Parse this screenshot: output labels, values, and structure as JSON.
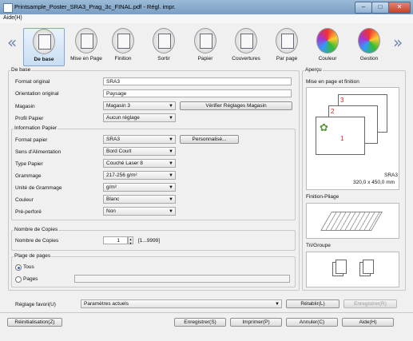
{
  "window": {
    "title": "Printsample_Poster_SRA3_Prag_3c_FINAL.pdf - Régl. impr."
  },
  "menu": {
    "help": "Aide(H)"
  },
  "toolbar": {
    "items": [
      {
        "label": "De base"
      },
      {
        "label": "Mise en Page"
      },
      {
        "label": "Finition"
      },
      {
        "label": "Sortir"
      },
      {
        "label": "Papier"
      },
      {
        "label": "Couvertures"
      },
      {
        "label": "Par page"
      },
      {
        "label": "Couleur"
      },
      {
        "label": "Gestion"
      }
    ]
  },
  "basic": {
    "group_title": "De base",
    "original_format_label": "Format original",
    "original_format_value": "SRA3",
    "original_orientation_label": "Orientation original",
    "original_orientation_value": "Paysage",
    "tray_label": "Magasin",
    "tray_value": "Magasin 3",
    "check_tray_button": "Vérifier Réglages Magasin",
    "paper_profile_label": "Profil Papier",
    "paper_profile_value": "Aucun réglage"
  },
  "paper_info": {
    "group_title": "Information Papier",
    "format_label": "Format papier",
    "format_value": "SRA3",
    "custom_button": "Personnalisé...",
    "feed_label": "Sens d'Alimentation",
    "feed_value": "Bord Court",
    "type_label": "Type Papier",
    "type_value": "Couché Laser 8",
    "weight_label": "Grammage",
    "weight_value": "217-256 g/m²",
    "unit_label": "Unité de Grammage",
    "unit_value": "g/m²",
    "color_label": "Couleur",
    "color_value": "Blanc",
    "prepunched_label": "Pré-perforé",
    "prepunched_value": "Non"
  },
  "copies": {
    "group_title": "Nombre de Copies",
    "label": "Nombre de Copies",
    "value": "1",
    "range": "[1...9999]"
  },
  "pages": {
    "group_title": "Plage de pages",
    "all_label": "Tous",
    "pages_label": "Pages"
  },
  "preview": {
    "group_title": "Aperçu",
    "layout_title": "Mise en page et finition",
    "size_name": "SRA3",
    "size_dims": "320,0 x 450,0 mm",
    "fold_title": "Finition-Pliage",
    "sort_title": "Tri/Groupe",
    "sheet_numbers": [
      "3",
      "2",
      "1"
    ]
  },
  "favorites": {
    "label": "Réglage favori(U)",
    "value": "Paramètres actuels",
    "recall_button": "Rétablir(L)",
    "save_button": "Enregistrer(R)"
  },
  "footer": {
    "reset": "Réinitialisation(Z)",
    "register": "Enregistrer(S)",
    "print": "Imprimer(P)",
    "cancel": "Annuler(C)",
    "help": "Aide(H)"
  }
}
